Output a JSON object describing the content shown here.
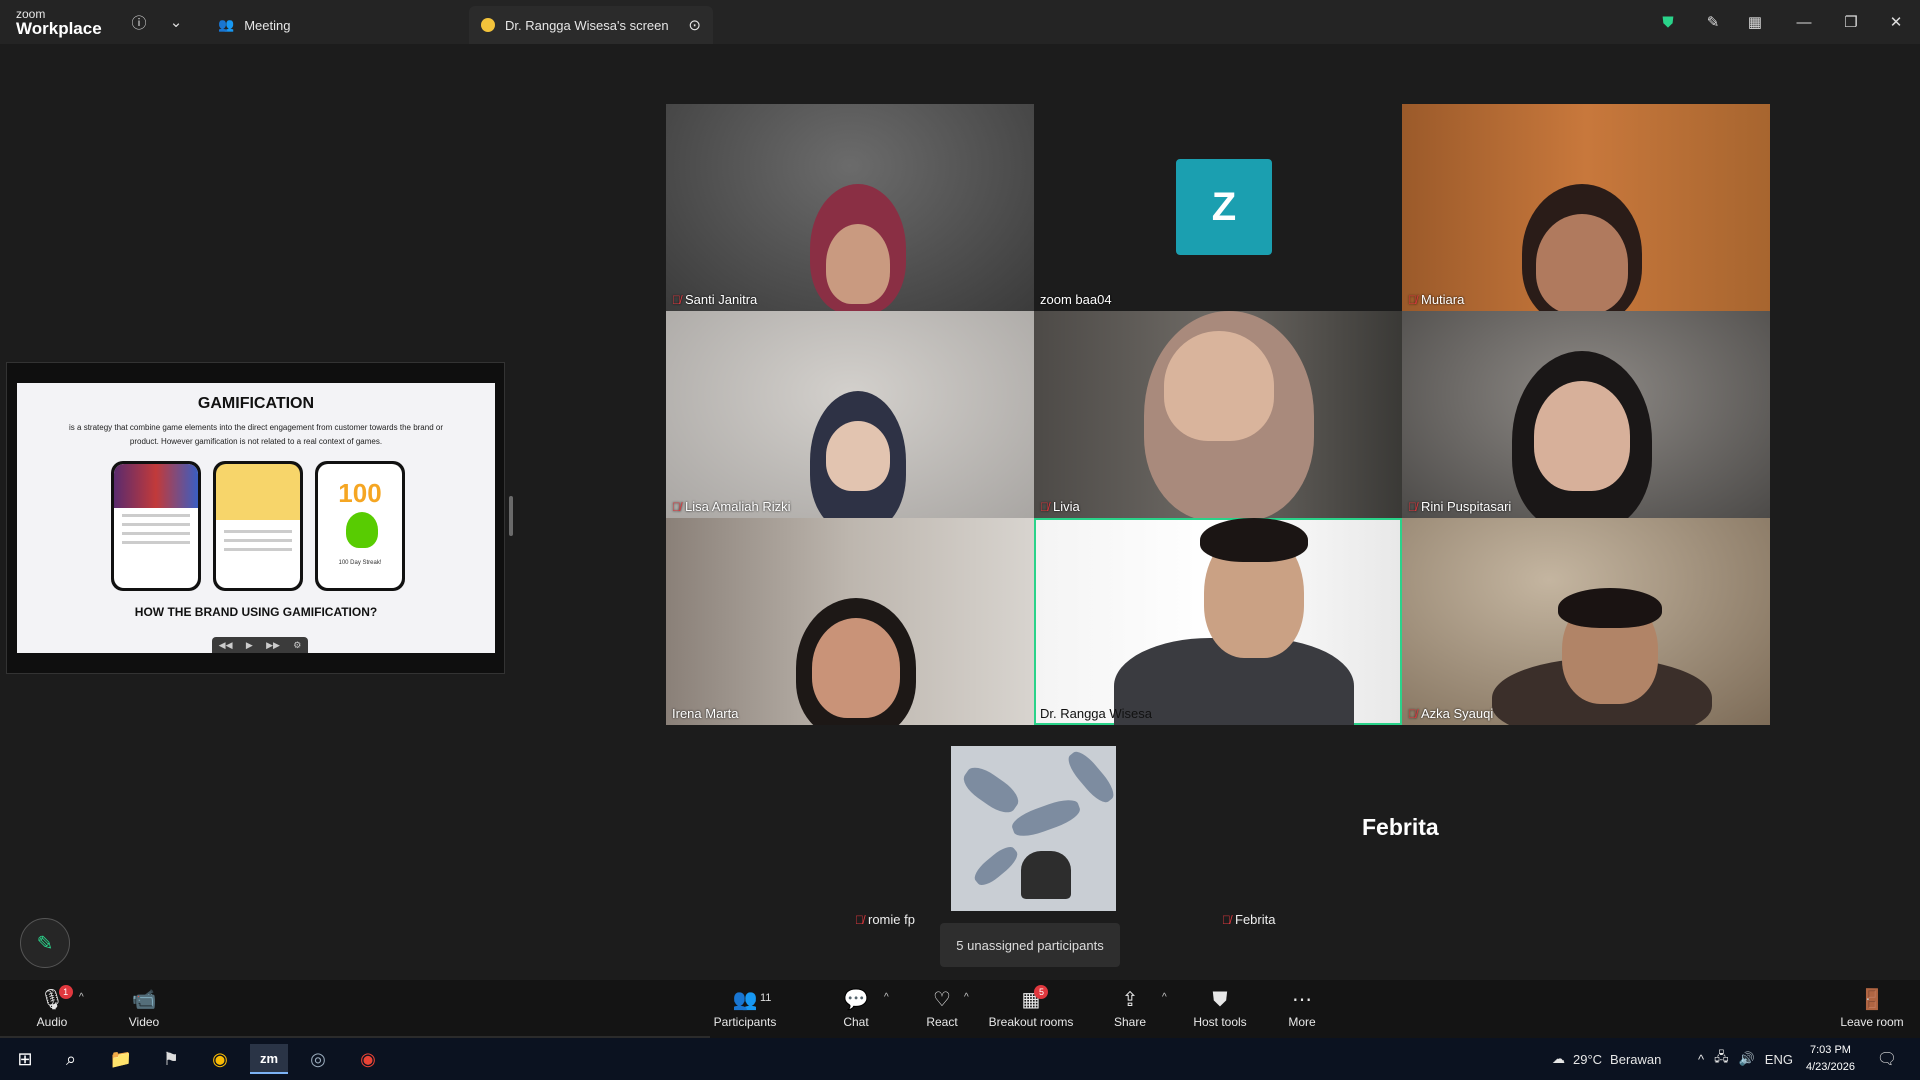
{
  "titlebar": {
    "brand_line1": "zoom",
    "brand_line2": "Workplace",
    "tab_meeting": "Meeting",
    "tab_screen": "Dr. Rangga Wisesa's screen"
  },
  "slide": {
    "title": "GAMIFICATION",
    "body": "is a strategy that combine game elements into the direct engagement from customer towards the brand or product. However gamification is not related to a real context of games.",
    "phone3_number": "100",
    "phone3_caption": "100 Day Streak!",
    "question": "HOW THE BRAND USING GAMIFICATION?"
  },
  "participants_grid": [
    {
      "name": "Santi Janitra",
      "muted": true
    },
    {
      "name": "zoom baa04",
      "muted": false,
      "avatar_letter": "Z"
    },
    {
      "name": "Mutiara",
      "muted": true
    },
    {
      "name": "Lisa Amaliah Rizki",
      "muted": true
    },
    {
      "name": "Livia",
      "muted": true
    },
    {
      "name": "Rini Puspitasari",
      "muted": true
    },
    {
      "name": "Irena Marta",
      "muted": false
    },
    {
      "name": "Dr. Rangga Wisesa",
      "muted": false,
      "speaking": true
    },
    {
      "name": "Azka Syauqi",
      "muted": true
    }
  ],
  "lower": {
    "romie_name": "romie fp",
    "febrita_big": "Febrita",
    "febrita_name": "Febrita",
    "unassigned": "5 unassigned participants"
  },
  "toolbar": {
    "audio": "Audio",
    "audio_badge": "1",
    "video": "Video",
    "participants": "Participants",
    "participants_count": "11",
    "chat": "Chat",
    "react": "React",
    "breakout": "Breakout rooms",
    "breakout_badge": "5",
    "share": "Share",
    "host_tools": "Host tools",
    "more": "More",
    "leave": "Leave room"
  },
  "taskbar": {
    "temperature": "29°C",
    "weather": "Berawan",
    "lang": "ENG",
    "time": "7:03 PM",
    "date": "4/23/2026"
  },
  "colors": {
    "speaking_border": "#2ad38a",
    "mute_red": "#e0383e",
    "avatar_teal": "#1b9fb0"
  }
}
